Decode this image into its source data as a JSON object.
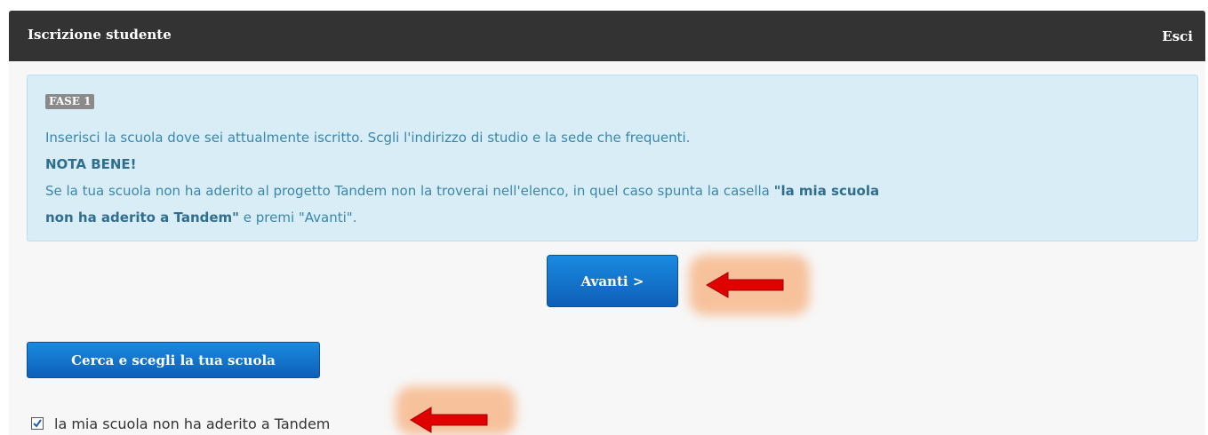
{
  "header": {
    "title": "Iscrizione studente",
    "exit_label": "Esci"
  },
  "info": {
    "phase": "FASE 1",
    "line1": "Inserisci la scuola dove sei attualmente iscritto. Scgli l'indirizzo di studio e la sede che frequenti.",
    "note_title": "NOTA BENE!",
    "line3_text": "Se la tua scuola non ha aderito al progetto Tandem non la troverai nell'elenco, in quel caso spunta la casella ",
    "line3_bold": "\"la mia scuola",
    "line4_bold": "non ha aderito a Tandem\"",
    "line4_text": " e premi \"Avanti\"."
  },
  "buttons": {
    "next_label": "Avanti >",
    "search_label": "Cerca e scegli la tua scuola"
  },
  "checkbox": {
    "label": "la mia scuola non ha aderito a Tandem",
    "checked": true
  },
  "colors": {
    "header_bg": "#333333",
    "info_bg": "#d9edf7",
    "info_text": "#3a87ad",
    "button_blue": "#0e6fcf",
    "arrow_red": "#e00000",
    "highlight": "#f7b88c"
  },
  "icons": [
    "check-icon",
    "red-arrow-left-icon"
  ]
}
